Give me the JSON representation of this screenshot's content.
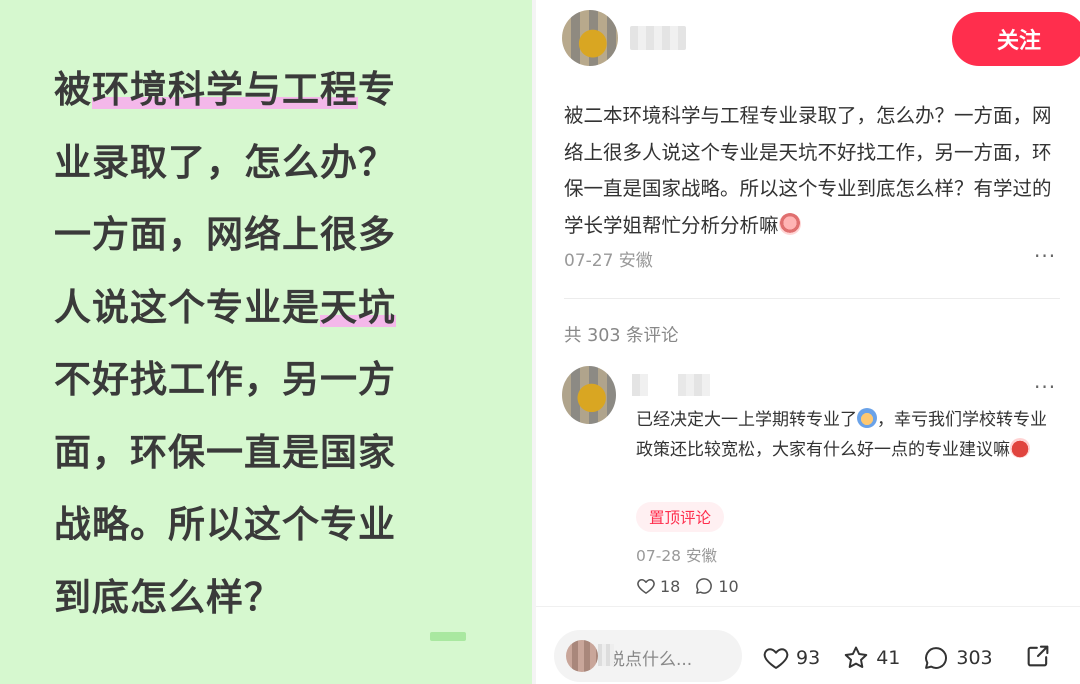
{
  "image_text": {
    "lines": [
      {
        "parts": [
          {
            "t": "被",
            "hl": false
          },
          {
            "t": "环境科学与工程",
            "hl": true
          },
          {
            "t": "专",
            "hl": false
          }
        ]
      },
      {
        "parts": [
          {
            "t": "业录取了，怎么办？",
            "hl": false
          }
        ]
      },
      {
        "parts": [
          {
            "t": "一方面，网络上很多",
            "hl": false
          }
        ]
      },
      {
        "parts": [
          {
            "t": "人说这个专业是",
            "hl": false
          },
          {
            "t": "天坑",
            "hl": true
          }
        ]
      },
      {
        "parts": [
          {
            "t": "不好找工作，另一方",
            "hl": false
          }
        ]
      },
      {
        "parts": [
          {
            "t": "面，环保一直是国家",
            "hl": false
          }
        ]
      },
      {
        "parts": [
          {
            "t": "战略。所以这个专业",
            "hl": false
          }
        ]
      },
      {
        "parts": [
          {
            "t": "到底怎么样？",
            "hl": false
          }
        ]
      }
    ]
  },
  "author": {
    "follow_label": "关注"
  },
  "post": {
    "body": "被二本环境科学与工程专业录取了，怎么办？一方面，网络上很多人说这个专业是天坑不好找工作，另一方面，环保一直是国家战略。所以这个专业到底怎么样？有学过的学长学姐帮忙分析分析嘛",
    "meta": "07-27 安徽",
    "more": "···"
  },
  "comments_header": "共 303 条评论",
  "comment": {
    "text_part1": "已经决定大一上学期转专业了",
    "text_part2": "，幸亏我们学校转专业政策还比较宽松，大家有什么好一点的专业建议嘛",
    "badge": "置顶评论",
    "meta": "07-28 安徽",
    "likes": "18",
    "replies": "10",
    "more": "···"
  },
  "bottom_bar": {
    "placeholder": "说点什么...",
    "likes": "93",
    "stars": "41",
    "comments": "303"
  },
  "colors": {
    "accent": "#ff2e4d",
    "image_bg": "#d6f8cf",
    "highlight": "#f4b8ea"
  }
}
